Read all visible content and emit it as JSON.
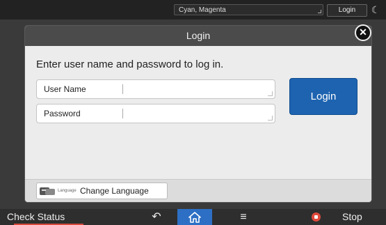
{
  "topbar": {
    "color_mode": "Cyan, Magenta",
    "login_label": "Login",
    "night_mode_icon": "moon-icon"
  },
  "dialog": {
    "title": "Login",
    "instruction": "Enter user name and password to log in.",
    "username_label": "User Name",
    "username_value": "",
    "password_label": "Password",
    "password_value": "",
    "login_button": "Login",
    "close_icon": "close-icon",
    "language_small_text": "Language",
    "language_button": "Change Language"
  },
  "bottombar": {
    "check_status": "Check Status",
    "back_icon": "back-arrow-icon",
    "home_icon": "home-icon",
    "menu_icon": "menu-icon",
    "stop_label": "Stop"
  },
  "colors": {
    "accent": "#1d63b0",
    "home_active": "#2d6fc4",
    "stop_red": "#e04a3b",
    "title_bar": "#4b4b4b",
    "panel": "#ececec"
  }
}
